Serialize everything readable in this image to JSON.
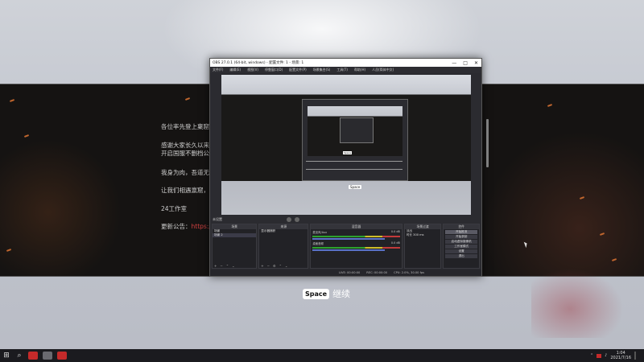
{
  "background": {
    "lines": [
      "各位率先登上稟窟",
      "感谢大家长久以来",
      "开启国服不删档公",
      "我身为肉，吾道无",
      "让我们相遇禀窟，",
      "24工作室"
    ],
    "update_prefix": "更新公告：",
    "update_link": "https:/",
    "space_key": "Space",
    "continue_text": "继续"
  },
  "obs": {
    "title": "OBS 27.0.1 (64-bit, windows) - 配置文件: 1 - 场景: 1",
    "title_controls": [
      "—",
      "□",
      "✕"
    ],
    "menus": [
      "文件(F)",
      "编辑(E)",
      "视图(V)",
      "停靠窗口(D)",
      "配置文件(P)",
      "场景集合(S)",
      "工具(T)",
      "帮助(H)",
      "人员(简体中文)"
    ],
    "preview_space_key": "Space",
    "scene_bar_label": "未设置",
    "docks": {
      "scenes": {
        "header": "场景",
        "items": [
          "场景",
          "场景 2"
        ],
        "selected": 1
      },
      "sources": {
        "header": "来源",
        "items": [
          "显示器捕获"
        ]
      },
      "mixer": {
        "header": "混音器",
        "channels": [
          {
            "name": "麦克风/Aux",
            "db": "0.0 dB"
          },
          {
            "name": "桌面音频",
            "db": "0.0 dB"
          }
        ]
      },
      "transitions": {
        "header": "场景过渡",
        "type": "淡出",
        "duration_label": "时长",
        "duration": "300 ms"
      },
      "controls": {
        "header": "控件",
        "buttons": [
          "开始推流",
          "开始录制",
          "启动虚拟摄像机",
          "工作室模式",
          "设置",
          "退出"
        ]
      }
    },
    "status": [
      "LIVE: 00:00:00",
      "REC: 00:00:00",
      "CPU: 2.0%, 30.00 fps"
    ]
  },
  "taskbar": {
    "start": "⊞",
    "search": "⌕",
    "time": "1:04",
    "date": "2021/7/16"
  },
  "colors": {
    "accent_link": "#d04040",
    "obs_bg": "#2b2b30",
    "taskbar_bg": "#1b1b1f"
  }
}
